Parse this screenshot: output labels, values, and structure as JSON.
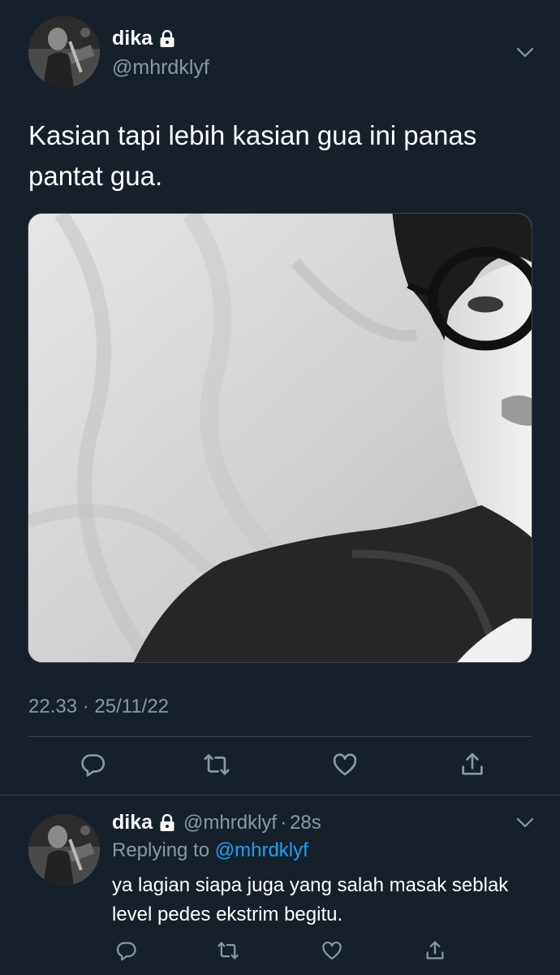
{
  "tweet": {
    "display_name": "dika",
    "handle": "@mhrdklyf",
    "text": "Kasian tapi lebih kasian gua ini panas pantat gua.",
    "timestamp": "22.33 · 25/11/22",
    "media": {
      "alt_subject": "black-and-white selfie photo"
    },
    "actions": [
      "reply-icon",
      "retweet-icon",
      "like-icon",
      "share-icon"
    ]
  },
  "reply": {
    "display_name": "dika",
    "handle": "@mhrdklyf",
    "separator": "·",
    "time": "28s",
    "replying_prefix": "Replying to",
    "replying_to": "@mhrdklyf",
    "text": "ya lagian siapa juga yang salah masak seblak level pedes ekstrim begitu.",
    "actions": [
      "reply-icon",
      "retweet-icon",
      "like-icon",
      "share-icon"
    ]
  },
  "colors": {
    "background": "#15202b",
    "primary_text": "#ffffff",
    "secondary_text": "#8899a6",
    "link": "#1da1f2",
    "divider": "#38444d"
  }
}
